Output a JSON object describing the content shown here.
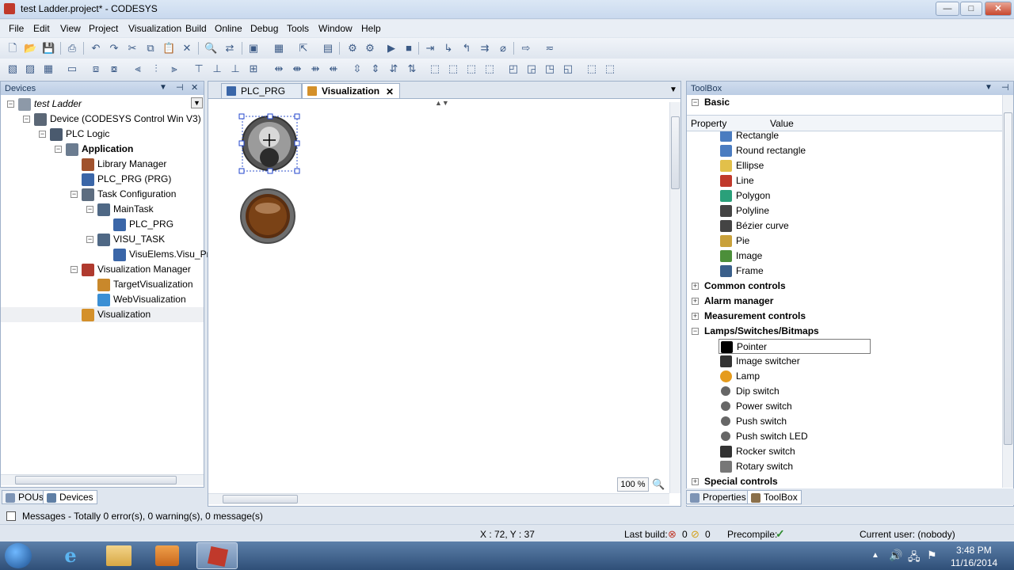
{
  "window": {
    "title": "test Ladder.project* - CODESYS",
    "minimize": "—",
    "maximize": "□",
    "close": "✕"
  },
  "menu": [
    "File",
    "Edit",
    "View",
    "Project",
    "Visualization",
    "Build",
    "Online",
    "Debug",
    "Tools",
    "Window",
    "Help"
  ],
  "devices_panel": {
    "title": "Devices",
    "pin": "⊣",
    "close": "✕",
    "tree": [
      {
        "label": "test Ladder",
        "indent": 0,
        "exp": "⊟",
        "icon": "project-icon",
        "style": "italic"
      },
      {
        "label": "Device (CODESYS Control Win V3)",
        "indent": 1,
        "exp": "⊟",
        "icon": "device-icon"
      },
      {
        "label": "PLC Logic",
        "indent": 2,
        "exp": "⊟",
        "icon": "plc-logic-icon"
      },
      {
        "label": "Application",
        "indent": 3,
        "exp": "⊟",
        "icon": "gear-icon",
        "style": "bold"
      },
      {
        "label": "Library Manager",
        "indent": 4,
        "exp": "",
        "icon": "library-icon"
      },
      {
        "label": "PLC_PRG (PRG)",
        "indent": 4,
        "exp": "",
        "icon": "pou-icon"
      },
      {
        "label": "Task Configuration",
        "indent": 4,
        "exp": "⊟",
        "icon": "task-config-icon"
      },
      {
        "label": "MainTask",
        "indent": 5,
        "exp": "⊟",
        "icon": "task-icon"
      },
      {
        "label": "PLC_PRG",
        "indent": 6,
        "exp": "",
        "icon": "pou-icon"
      },
      {
        "label": "VISU_TASK",
        "indent": 5,
        "exp": "⊟",
        "icon": "task-icon"
      },
      {
        "label": "VisuElems.Visu_Prg",
        "indent": 6,
        "exp": "",
        "icon": "pou-icon"
      },
      {
        "label": "Visualization Manager",
        "indent": 4,
        "exp": "⊟",
        "icon": "visu-manager-icon"
      },
      {
        "label": "TargetVisualization",
        "indent": 5,
        "exp": "",
        "icon": "target-visu-icon"
      },
      {
        "label": "WebVisualization",
        "indent": 5,
        "exp": "",
        "icon": "web-visu-icon"
      },
      {
        "label": "Visualization",
        "indent": 4,
        "exp": "",
        "icon": "visualization-icon",
        "selected": true
      }
    ],
    "bottom_tabs": [
      "POUs",
      "Devices"
    ]
  },
  "editor": {
    "tabs": [
      {
        "label": "PLC_PRG",
        "active": false
      },
      {
        "label": "Visualization",
        "active": true
      }
    ],
    "tab_close": "✕",
    "zoom": "100 %"
  },
  "toolbox": {
    "title": "ToolBox",
    "category_basic": "Basic",
    "property_header": "Property",
    "value_header": "Value",
    "basic_items": [
      "Rectangle",
      "Round rectangle",
      "Ellipse",
      "Line",
      "Polygon",
      "Polyline",
      "Bézier curve",
      "Pie",
      "Image",
      "Frame"
    ],
    "categories": [
      "Common controls",
      "Alarm manager",
      "Measurement controls",
      "Lamps/Switches/Bitmaps"
    ],
    "lamp_items": [
      "Pointer",
      "Image switcher",
      "Lamp",
      "Dip switch",
      "Power switch",
      "Push switch",
      "Push switch LED",
      "Rocker switch",
      "Rotary switch"
    ],
    "special": "Special controls",
    "bottom_tabs": [
      "Properties",
      "ToolBox"
    ]
  },
  "messages": {
    "text": "Messages - Totally 0 error(s), 0 warning(s), 0 message(s)"
  },
  "status": {
    "coords": "X : 72, Y : 37",
    "last_build_label": "Last build:",
    "errors": "0",
    "warnings": "0",
    "precompile_label": "Precompile:",
    "current_user": "Current user: (nobody)"
  },
  "taskbar": {
    "time": "3:48 PM",
    "date": "11/16/2014"
  }
}
